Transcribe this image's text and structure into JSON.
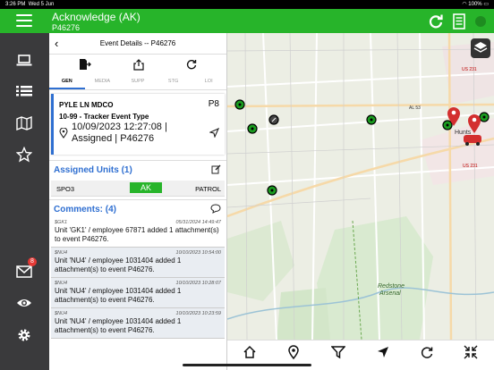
{
  "status": {
    "time": "3:26 PM",
    "date": "Wed 5 Jun",
    "battery": "100%"
  },
  "header": {
    "title": "Acknowledge (AK)",
    "subtitle": "P46276"
  },
  "sidebar": {
    "mail_badge": "8"
  },
  "panel": {
    "title": "Event Details -- P46276",
    "tabs": [
      "GEN",
      "MEDIA",
      "SUPP",
      "STG",
      "LOI"
    ],
    "event": {
      "location": "PYLE LN MDCO",
      "priority": "P8",
      "type": "10-99 - Tracker Event Type",
      "datetime": "10/09/2023 12:27:08 | Assigned | P46276"
    },
    "assigned_units_header": "Assigned Units (1)",
    "unit": {
      "name": "SPO3",
      "status": "AK",
      "role": "PATROL"
    },
    "comments_header": "Comments: (4)",
    "comments": [
      {
        "who": "$GK1",
        "when": "05/31/2024 14:49:47",
        "text": "Unit 'GK1' / employee 67871 added 1 attachment(s) to event P46276."
      },
      {
        "who": "$NU4",
        "when": "10/10/2023 10:54:00",
        "text": "Unit 'NU4' / employee 1031404 added 1 attachment(s) to event P46276."
      },
      {
        "who": "$NU4",
        "when": "10/10/2023 10:28:07",
        "text": "Unit 'NU4' / employee 1031404 added 1 attachment(s) to event P46276."
      },
      {
        "who": "$NU4",
        "when": "10/10/2023 10:23:59",
        "text": "Unit 'NU4' / employee 1031404 added 1 attachment(s) to event P46276."
      }
    ]
  },
  "map": {
    "labels": {
      "shield1": "US 231",
      "shield2": "AL 53",
      "shield3": "US 231",
      "city": "Hunts",
      "redstone1": "Redstone",
      "redstone2": "Arsenal"
    }
  },
  "colors": {
    "accent_green": "#27b42a",
    "accent_blue": "#2f6fd1",
    "sidebar": "#3a3a3c"
  }
}
